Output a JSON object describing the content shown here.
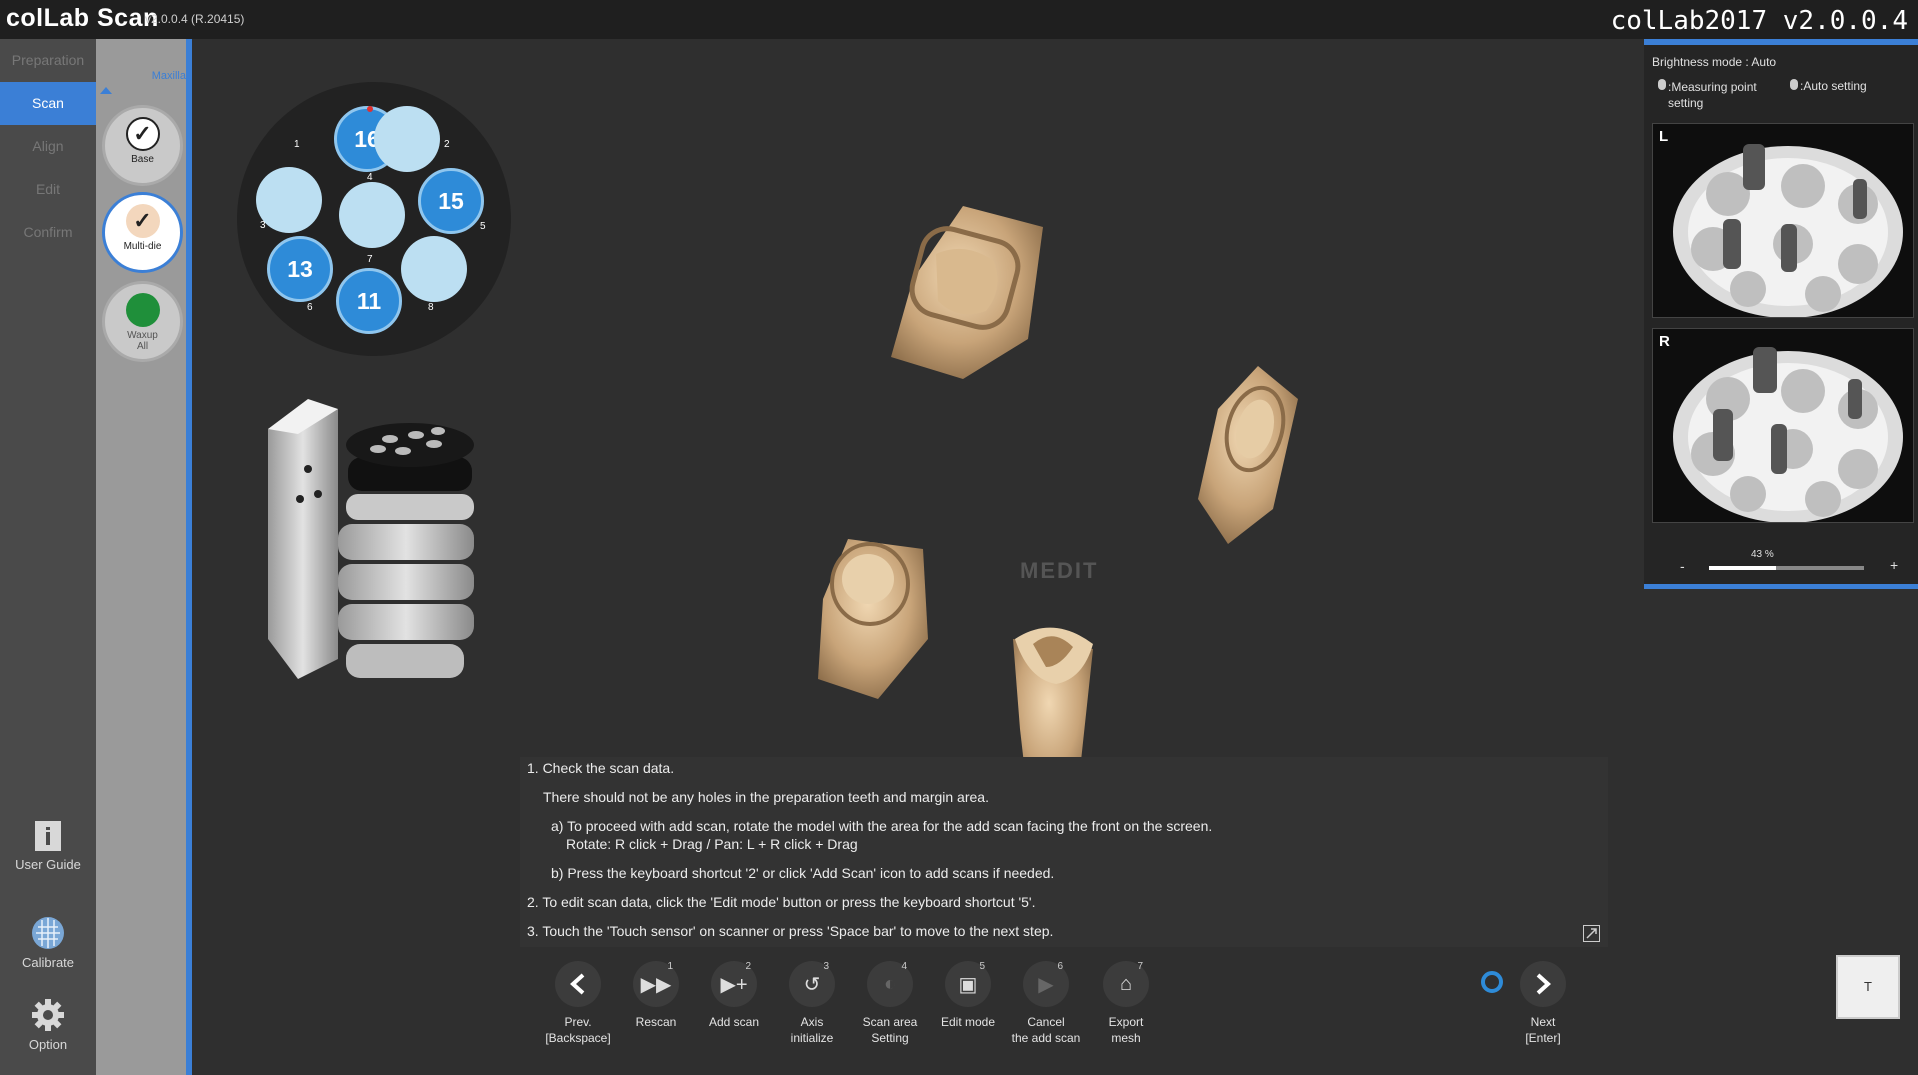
{
  "app": {
    "logo": "colLab Scan",
    "version": "v2.0.0.4  (R.20415)",
    "window_title": "colLab2017 v2.0.0.4"
  },
  "steps": [
    "Preparation",
    "Scan",
    "Align",
    "Edit",
    "Confirm"
  ],
  "tools": {
    "user_guide": "User Guide",
    "calibrate": "Calibrate",
    "option": "Option"
  },
  "modes": {
    "jaw_label": "Maxilla",
    "base": "Base",
    "multi_die": "Multi-die",
    "waxup": "Waxup\nAll"
  },
  "die_holder": {
    "slots": [
      {
        "num": "1",
        "tooth": "16"
      },
      {
        "num": "2",
        "tooth": ""
      },
      {
        "num": "3",
        "tooth": ""
      },
      {
        "num": "4",
        "tooth": ""
      },
      {
        "num": "5",
        "tooth": "15"
      },
      {
        "num": "6",
        "tooth": "13"
      },
      {
        "num": "7",
        "tooth": "11"
      },
      {
        "num": "8",
        "tooth": ""
      }
    ]
  },
  "watermark": "MEDIT",
  "instructions": {
    "l1": "1. Check the scan data.",
    "l2": "There should not be any holes in the preparation teeth and margin area.",
    "l3": "a) To proceed with add scan, rotate the model with the area for the add scan facing the front on the screen.",
    "l4": "Rotate: R click + Drag / Pan: L + R click + Drag",
    "l5": "b) Press the keyboard shortcut '2' or click 'Add Scan' icon to add scans if needed.",
    "l6": "2. To edit scan data, click the 'Edit mode' button or press the keyboard shortcut '5'.",
    "l7": "3. Touch the 'Touch sensor' on scanner or press 'Space bar' to move to the next step."
  },
  "toolbar": [
    {
      "key": "",
      "label": "Prev.\n[Backspace]",
      "icon": "chevron-left-icon"
    },
    {
      "key": "1",
      "label": "Rescan",
      "icon": "rescan-icon"
    },
    {
      "key": "2",
      "label": "Add scan",
      "icon": "add-scan-icon"
    },
    {
      "key": "3",
      "label": "Axis\ninitialize",
      "icon": "axis-reset-icon"
    },
    {
      "key": "4",
      "label": "Scan area\nSetting",
      "icon": "scan-area-icon"
    },
    {
      "key": "5",
      "label": "Edit mode",
      "icon": "edit-mode-icon"
    },
    {
      "key": "6",
      "label": "Cancel\nthe add scan",
      "icon": "cancel-add-scan-icon"
    },
    {
      "key": "7",
      "label": "Export\nmesh",
      "icon": "export-mesh-icon"
    }
  ],
  "next": {
    "label": "Next\n[Enter]"
  },
  "touch_pad": "T",
  "right_panel": {
    "brightness": "Brightness mode : Auto",
    "measuring": ":Measuring point\nsetting",
    "auto": ":Auto setting",
    "cam_left": "L",
    "cam_right": "R",
    "zoom_minus": "-",
    "zoom_plus": "+",
    "zoom_value": "43 %",
    "zoom_fraction": 0.43
  },
  "colors": {
    "accent": "#3b7fd6",
    "die_filled": "#2e8bd8",
    "die_empty": "#bcdff2",
    "waxup": "#1f8f3a",
    "stone": "#cfae86"
  }
}
